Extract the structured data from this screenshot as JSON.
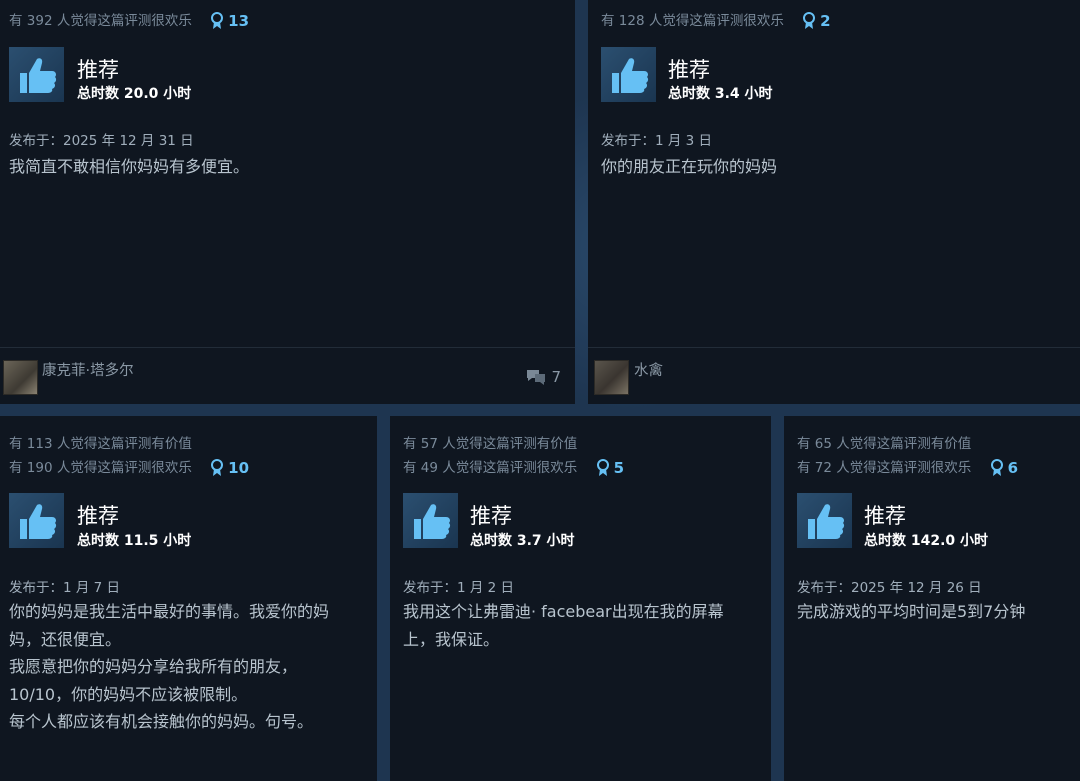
{
  "colors": {
    "accent": "#66c0f4",
    "card_bg": "#0f1620",
    "page_bg": "#1e3550"
  },
  "reviews": [
    {
      "helpful_valuable": "",
      "helpful_funny": "有 392 人觉得这篇评测很欢乐",
      "awards": "13",
      "recommendation": "推荐",
      "hours": "总时数 20.0 小时",
      "posted": "发布于：2025 年 12 月 31 日",
      "text": "我简直不敢相信你妈妈有多便宜。",
      "author": "康克菲·塔多尔",
      "comment_count": "7"
    },
    {
      "helpful_valuable": "",
      "helpful_funny": "有 128 人觉得这篇评测很欢乐",
      "awards": "2",
      "recommendation": "推荐",
      "hours": "总时数 3.4 小时",
      "posted": "发布于：1 月 3 日",
      "text": "你的朋友正在玩你的妈妈",
      "author": "水禽",
      "comment_count": ""
    },
    {
      "helpful_valuable": "有 113 人觉得这篇评测有价值",
      "helpful_funny": "有 190 人觉得这篇评测很欢乐",
      "awards": "10",
      "recommendation": "推荐",
      "hours": "总时数 11.5 小时",
      "posted": "发布于：1 月 7 日",
      "text": "你的妈妈是我生活中最好的事情。我爱你的妈\n妈，还很便宜。\n我愿意把你的妈妈分享给我所有的朋友，\n10/10，你的妈妈不应该被限制。\n每个人都应该有机会接触你的妈妈。句号。",
      "author": "",
      "comment_count": ""
    },
    {
      "helpful_valuable": "有 57 人觉得这篇评测有价值",
      "helpful_funny": "有 49 人觉得这篇评测很欢乐",
      "awards": "5",
      "recommendation": "推荐",
      "hours": "总时数 3.7 小时",
      "posted": "发布于：1 月 2 日",
      "text": "我用这个让弗雷迪· facebear出现在我的屏幕\n上，我保证。",
      "author": "",
      "comment_count": ""
    },
    {
      "helpful_valuable": "有 65 人觉得这篇评测有价值",
      "helpful_funny": "有 72 人觉得这篇评测很欢乐",
      "awards": "6",
      "recommendation": "推荐",
      "hours": "总时数 142.0 小时",
      "posted": "发布于：2025 年 12 月 26 日",
      "text": "完成游戏的平均时间是5到7分钟",
      "author": "",
      "comment_count": ""
    }
  ]
}
